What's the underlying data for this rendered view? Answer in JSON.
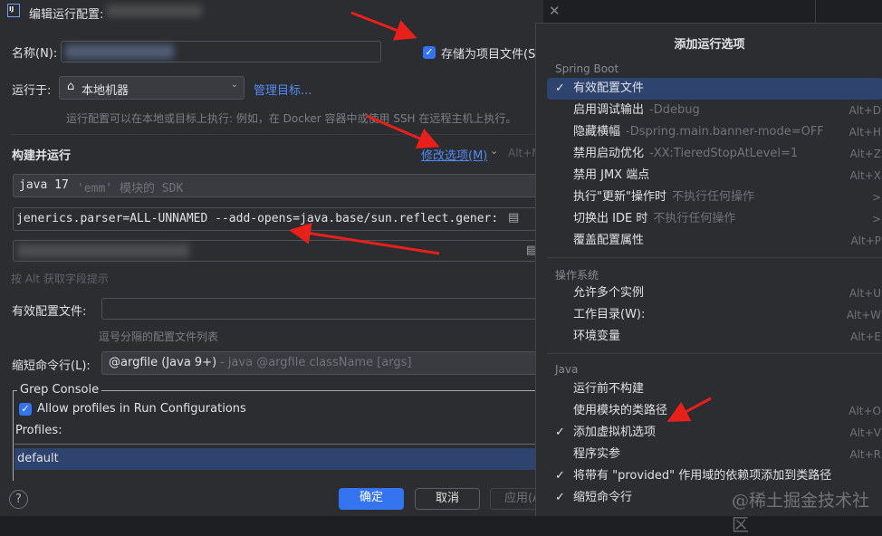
{
  "dialog": {
    "title": "编辑运行配置:",
    "name_label": "名称(N):",
    "store_as_project_file": "存储为项目文件(S",
    "run_on_label": "运行于:",
    "run_on_value": "本地机器",
    "manage_targets": "管理目标...",
    "run_on_hint": "运行配置可以在本地或目标上执行: 例如，在 Docker 容器中或使用 SSH 在远程主机上执行。",
    "build_and_run": "构建并运行",
    "modify_options": "修改选项(M)",
    "modify_options_shortcut": "Alt+M",
    "sdk_value": "java 17",
    "sdk_hint": "'emm' 模块的 SDK",
    "vm_options_value": "jenerics.parser=ALL-UNNAMED --add-opens=java.base/sun.reflect.gener:",
    "alt_hint": "按 Alt 获取字段提示",
    "active_profiles_label": "有效配置文件:",
    "active_profiles_hint": "逗号分隔的配置文件列表",
    "shorten_cmd_label": "缩短命令行(L):",
    "shorten_cmd_value": "@argfile (Java 9+)",
    "shorten_cmd_hint": "- java @argfile className [args]",
    "grep_console_title": "Grep Console",
    "allow_profiles": "Allow profiles in Run Configurations",
    "profiles_label": "Profiles:",
    "profiles": [
      "default"
    ],
    "ok": "确定",
    "cancel": "取消",
    "apply": "应用(A",
    "help": "?"
  },
  "popup": {
    "title": "添加运行选项",
    "sections": [
      {
        "header": "Spring Boot",
        "items": [
          {
            "label": "有效配置文件",
            "checked": true,
            "selected": true,
            "hint": "",
            "shortcut": ""
          },
          {
            "label": "启用调试输出",
            "hint": "-Ddebug",
            "shortcut": "Alt+D"
          },
          {
            "label": "隐藏横幅",
            "hint": "-Dspring.main.banner-mode=OFF",
            "shortcut": "Alt+H"
          },
          {
            "label": "禁用启动优化",
            "hint": "-XX:TieredStopAtLevel=1",
            "shortcut": "Alt+Z"
          },
          {
            "label": "禁用 JMX 端点",
            "hint": "",
            "shortcut": "Alt+X"
          },
          {
            "label": "执行\"更新\"操作时",
            "hint": "不执行任何操作",
            "shortcut": ">"
          },
          {
            "label": "切换出 IDE 时",
            "hint": "不执行任何操作",
            "shortcut": ">"
          },
          {
            "label": "覆盖配置属性",
            "hint": "",
            "shortcut": "Alt+P"
          }
        ]
      },
      {
        "header": "操作系统",
        "items": [
          {
            "label": "允许多个实例",
            "hint": "",
            "shortcut": "Alt+U"
          },
          {
            "label": "工作目录(W):",
            "hint": "",
            "shortcut": "Alt+W"
          },
          {
            "label": "环境变量",
            "hint": "",
            "shortcut": "Alt+E"
          }
        ]
      },
      {
        "header": "Java",
        "items": [
          {
            "label": "运行前不构建",
            "hint": "",
            "shortcut": ""
          },
          {
            "label": "使用模块的类路径",
            "hint": "",
            "shortcut": "Alt+O"
          },
          {
            "label": "添加虚拟机选项",
            "checked": true,
            "hint": "",
            "shortcut": "Alt+V"
          },
          {
            "label": "程序实参",
            "hint": "",
            "shortcut": "Alt+R"
          },
          {
            "label": "将带有 \"provided\" 作用域的依赖项添加到类路径",
            "checked": true,
            "hint": "",
            "shortcut": ""
          },
          {
            "label": "缩短命令行",
            "checked": true,
            "hint": "",
            "shortcut": ""
          }
        ]
      }
    ]
  },
  "watermark": "@稀土掘金技术社区",
  "colors": {
    "accent": "#3574f0",
    "selection": "#2e436e",
    "link": "#548af7",
    "annotation": "#e8201c"
  }
}
